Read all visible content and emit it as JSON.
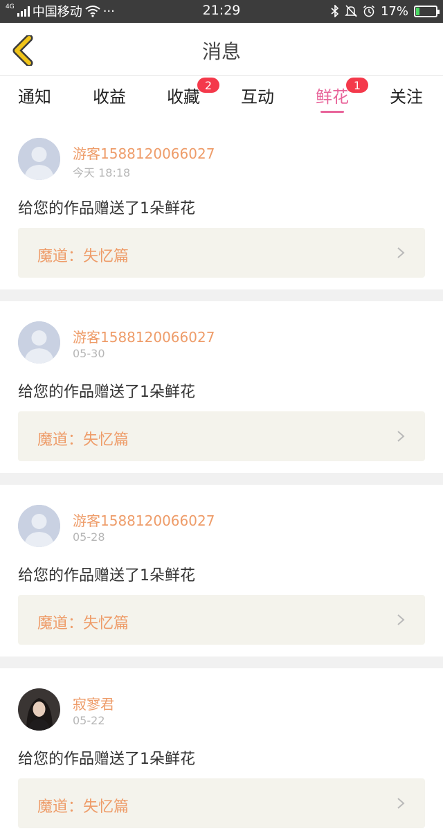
{
  "status_bar": {
    "network": "4G",
    "carrier": "中国移动",
    "more": "···",
    "time": "21:29",
    "battery_text": "17%",
    "battery_level": 0.17,
    "battery_color": "#4cd964"
  },
  "nav": {
    "title": "消息",
    "back_icon": "chevron-left-icon",
    "back_color": "#f0c419"
  },
  "tabs": [
    {
      "label": "通知"
    },
    {
      "label": "收益"
    },
    {
      "label": "收藏",
      "badge": "2"
    },
    {
      "label": "互动"
    },
    {
      "label": "鲜花",
      "badge": "1",
      "active": true
    },
    {
      "label": "关注"
    }
  ],
  "colors": {
    "accent": "#e8649a",
    "name": "#ee9c69",
    "badge": "#f4394b"
  },
  "messages": [
    {
      "user": "游客1588120066027",
      "time": "今天 18:18",
      "text": "给您的作品赠送了1朵鲜花",
      "work": "魔道：失忆篇"
    },
    {
      "user": "游客1588120066027",
      "time": "05-30",
      "text": "给您的作品赠送了1朵鲜花",
      "work": "魔道：失忆篇"
    },
    {
      "user": "游客1588120066027",
      "time": "05-28",
      "text": "给您的作品赠送了1朵鲜花",
      "work": "魔道：失忆篇"
    },
    {
      "user": "寂寥君",
      "time": "05-22",
      "text": "给您的作品赠送了1朵鲜花",
      "work": "魔道：失忆篇"
    }
  ]
}
